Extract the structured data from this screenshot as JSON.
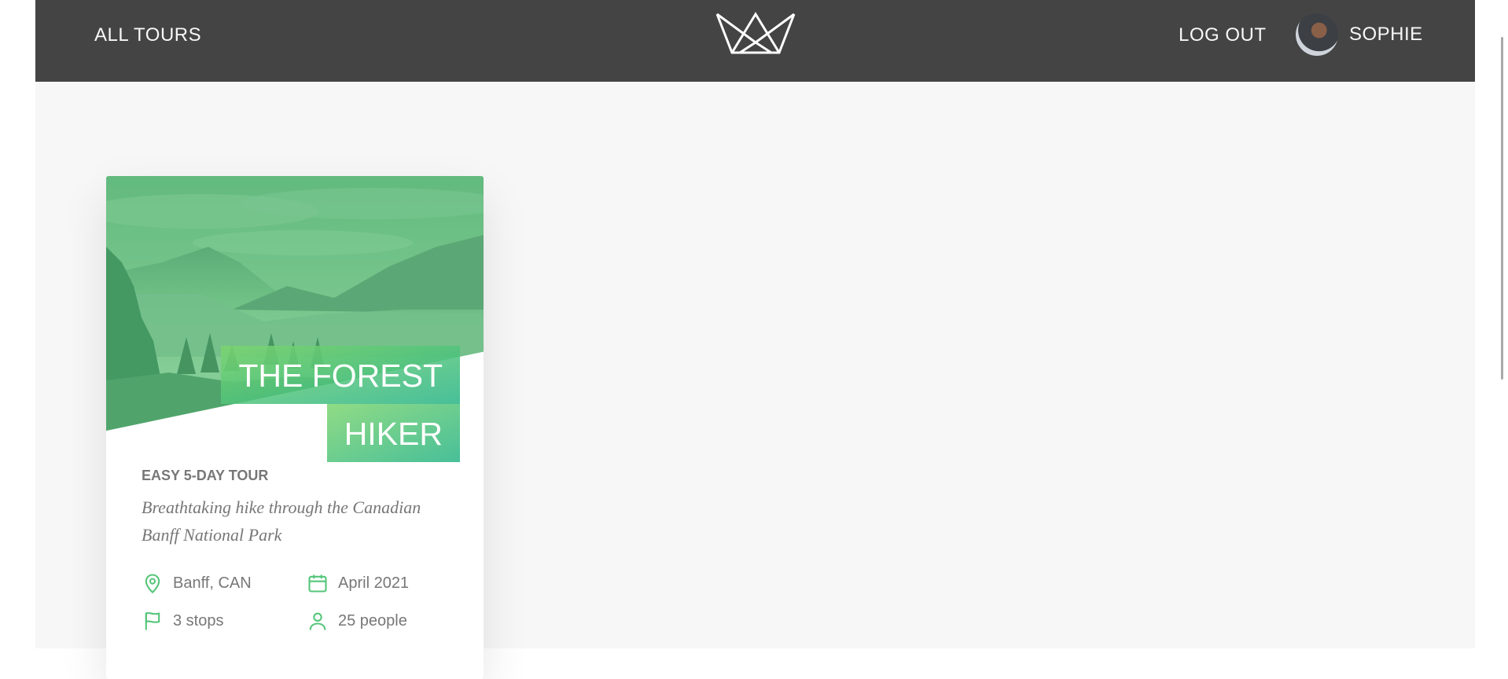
{
  "header": {
    "all_tours": "ALL TOURS",
    "log_out": "LOG OUT",
    "user_name": "SOPHIE",
    "logo_icon": "crown-icon",
    "avatar_icon": "user-avatar"
  },
  "tour_card": {
    "title_line1": "THE FOREST",
    "title_line2": "HIKER",
    "difficulty": "EASY 5-DAY TOUR",
    "summary": "Breathtaking hike through the Canadian Banff National Park",
    "details": {
      "location": "Banff, CAN",
      "date": "April 2021",
      "stops": "3 stops",
      "group_size": "25 people"
    },
    "accent_color": "#55c57a"
  }
}
